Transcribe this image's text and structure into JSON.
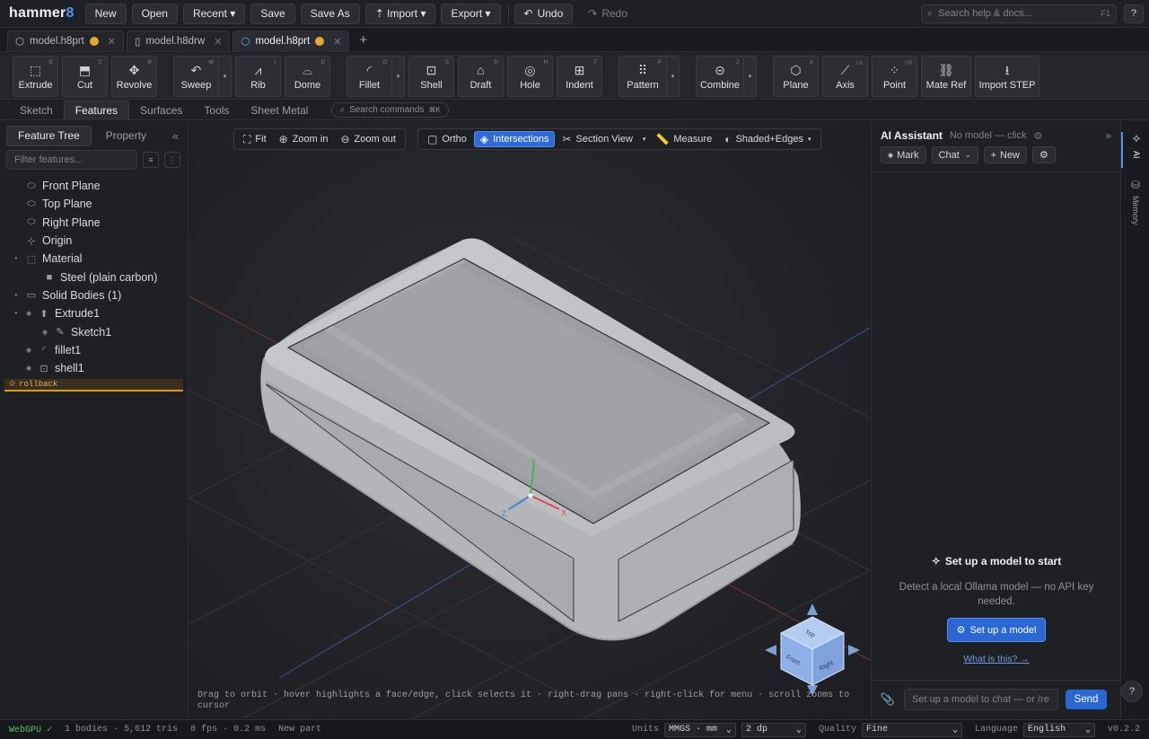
{
  "app": {
    "logo_main": "hammer",
    "logo_num": "8"
  },
  "topbar": {
    "buttons": [
      "New",
      "Open",
      "Recent ▾",
      "Save",
      "Save As",
      "⇡ Import ▾",
      "Export ▾"
    ],
    "undo": "Undo",
    "redo": "Redo",
    "search_placeholder": "Search help & docs...",
    "search_key": "F1",
    "help": "?"
  },
  "tabs": [
    {
      "name": "model.h8prt",
      "dirty": true
    },
    {
      "name": "model.h8drw",
      "dirty": false
    },
    {
      "name": "model.h8prt",
      "dirty": true
    }
  ],
  "ribbon": [
    {
      "label": "Extrude",
      "icon": "⬚",
      "key": "E"
    },
    {
      "label": "Cut",
      "icon": "⬒",
      "key": "C"
    },
    {
      "label": "Revolve",
      "icon": "✥",
      "key": "R"
    },
    {
      "label": "Sweep",
      "icon": "↶",
      "key": "W"
    },
    {
      "label": "Rib",
      "icon": "⩘",
      "key": "I"
    },
    {
      "label": "Dome",
      "icon": "⌓",
      "key": "D"
    },
    {
      "label": "Fillet",
      "icon": "◜",
      "key": "G"
    },
    {
      "label": "Shell",
      "icon": "⊡",
      "key": "S"
    },
    {
      "label": "Draft",
      "icon": "⌂",
      "key": "D"
    },
    {
      "label": "Hole",
      "icon": "◎",
      "key": "H"
    },
    {
      "label": "Indent",
      "icon": "⊞",
      "key": "T"
    },
    {
      "label": "Pattern",
      "icon": "⠿",
      "key": "P"
    },
    {
      "label": "Combine",
      "icon": "⊝",
      "key": "J"
    },
    {
      "label": "Plane",
      "icon": "⬡",
      "key": "A"
    },
    {
      "label": "Axis",
      "icon": "⟋",
      "key": "⇧A"
    },
    {
      "label": "Point",
      "icon": "⁘",
      "key": "⇧P"
    },
    {
      "label": "Mate Ref",
      "icon": "⛓",
      "key": ""
    },
    {
      "label": "Import STEP",
      "icon": "⭳",
      "key": ""
    }
  ],
  "modetabs": [
    "Sketch",
    "Features",
    "Surfaces",
    "Tools",
    "Sheet Metal"
  ],
  "modetab_active": "Features",
  "cmd_search": "Search commands",
  "cmd_key": "⌘K",
  "leftpanel": {
    "tab1": "Feature Tree",
    "tab2": "Property",
    "filter_placeholder": "Filter features..."
  },
  "tree": [
    {
      "label": "Front Plane",
      "icon": "⬭",
      "indent": 0
    },
    {
      "label": "Top Plane",
      "icon": "⬭",
      "indent": 0
    },
    {
      "label": "Right Plane",
      "icon": "⬭",
      "indent": 0
    },
    {
      "label": "Origin",
      "icon": "⊹",
      "indent": 0
    },
    {
      "label": "Material",
      "icon": "⬚",
      "indent": 0
    },
    {
      "label": "Steel (plain carbon)",
      "icon": "■",
      "indent": 1
    },
    {
      "label": "Solid Bodies (1)",
      "icon": "▭",
      "indent": 0
    },
    {
      "label": "Extrude1",
      "icon": "⬆",
      "indent": 0,
      "eye": true
    },
    {
      "label": "Sketch1",
      "icon": "✎",
      "indent": 1,
      "eye": true
    },
    {
      "label": "fillet1",
      "icon": "◜",
      "indent": 0,
      "eye": true
    },
    {
      "label": "shell1",
      "icon": "⊡",
      "indent": 0,
      "eye": true
    }
  ],
  "rollback": "rollback",
  "viewport": {
    "fit": "Fit",
    "zoom_in": "Zoom in",
    "zoom_out": "Zoom out",
    "ortho": "Ortho",
    "intersections": "Intersections",
    "section": "Section View",
    "measure": "Measure",
    "shading": "Shaded+Edges",
    "hint": "Drag to orbit · hover highlights a face/edge, click selects it · right-drag pans · right-click for menu · scroll zooms to cursor",
    "axis_x": "X",
    "axis_y": "Y",
    "axis_z": "Z",
    "cube_top": "Top",
    "cube_front": "Front",
    "cube_right": "Right"
  },
  "ai": {
    "title": "AI Assistant",
    "subtitle": "No model — click",
    "mark": "Mark",
    "mode": "Chat",
    "new": "New",
    "empty_title": "Set up a model to start",
    "empty_desc": "Detect a local Ollama model — no API key needed.",
    "cta": "Set up a model",
    "link": "What is this? →",
    "chat_placeholder": "Set up a model to chat — or /re",
    "send": "Send"
  },
  "rail": {
    "ai": "AI",
    "memory": "Memory"
  },
  "status": {
    "gpu": "WebGPU ✓",
    "stats": "1 bodies · 5,612 tris",
    "fps": "8 fps · 0.2 ms",
    "mode": "New part",
    "units_label": "Units",
    "units": "MMGS · mm",
    "dp": "2 dp",
    "quality_label": "Quality",
    "quality": "Fine",
    "lang_label": "Language",
    "lang": "English",
    "version": "v0.2.2"
  },
  "colors": {
    "accent": "#2f6bd8",
    "dirty": "#e8a631",
    "rollback": "#d99a2e",
    "gpu_ok": "#5cc46a"
  }
}
